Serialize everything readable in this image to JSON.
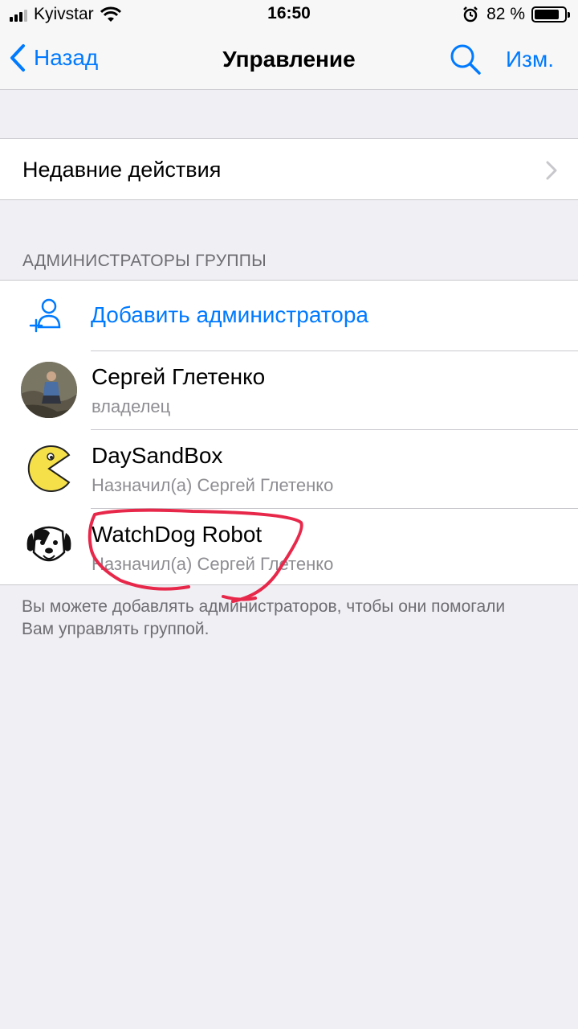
{
  "status_bar": {
    "carrier": "Kyivstar",
    "time": "16:50",
    "battery_text": "82 %",
    "battery_level": 0.82
  },
  "nav": {
    "back_label": "Назад",
    "title": "Управление",
    "edit_label": "Изм."
  },
  "recent_actions": {
    "label": "Недавние действия"
  },
  "admins_section": {
    "header": "АДМИНИСТРАТОРЫ ГРУППЫ",
    "add_label": "Добавить администратора",
    "items": [
      {
        "name": "Сергей Глетенко",
        "subtitle": "владелец",
        "avatar": "photo-avatar"
      },
      {
        "name": "DaySandBox",
        "subtitle": "Назначил(а) Сергей Глетенко",
        "avatar": "pacman-avatar"
      },
      {
        "name": "WatchDog Robot",
        "subtitle": "Назначил(а) Сергей Глетенко",
        "avatar": "dog-avatar"
      }
    ]
  },
  "footer": {
    "text": "Вы можете добавлять администраторов, чтобы они помогали Вам управлять группой."
  },
  "colors": {
    "accent": "#007aff",
    "annotation": "#e8284a",
    "background": "#efeff4"
  }
}
